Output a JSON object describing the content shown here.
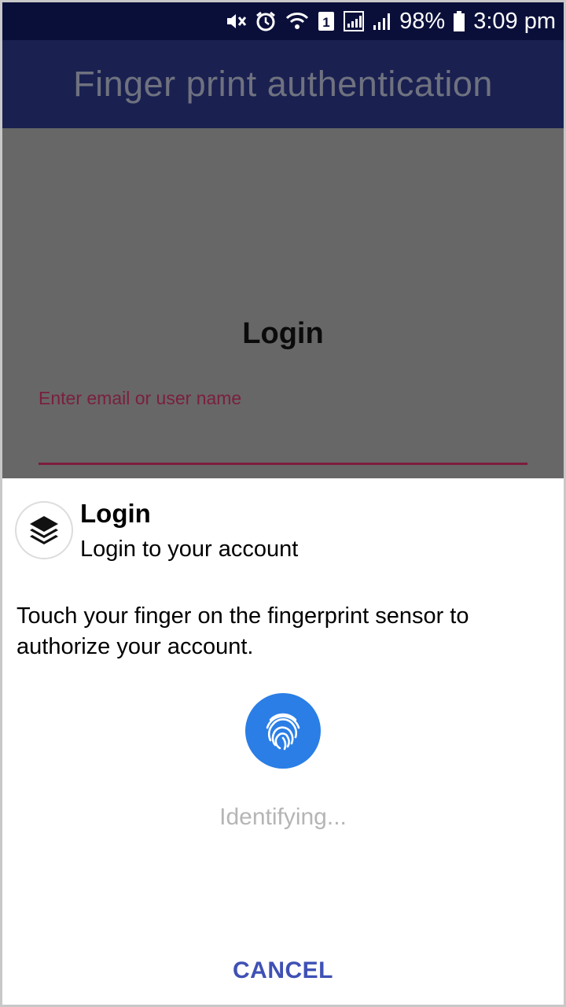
{
  "status_bar": {
    "battery_percent": "98%",
    "time": "3:09 pm",
    "sim_label": "1",
    "icons": [
      "mute-vibrate-icon",
      "alarm-icon",
      "wifi-icon",
      "sim-icon",
      "signal-icon",
      "signal-icon",
      "battery-icon"
    ],
    "background": "#0a0f3a"
  },
  "toolbar": {
    "title": "Finger print authentication",
    "background": "#1a2151"
  },
  "login_form": {
    "heading": "Login",
    "email_placeholder": "Enter email or user name",
    "accent": "#7d1c3c"
  },
  "dialog": {
    "title": "Login",
    "subtitle": "Login to your account",
    "description": "Touch your finger on the fingerprint sensor to authorize your account.",
    "status": "Identifying...",
    "cancel_label": "CANCEL",
    "app_icon": "layers-icon",
    "fingerprint_icon": "fingerprint-icon",
    "fingerprint_color": "#2a7ee6",
    "button_color": "#3f51b5"
  }
}
